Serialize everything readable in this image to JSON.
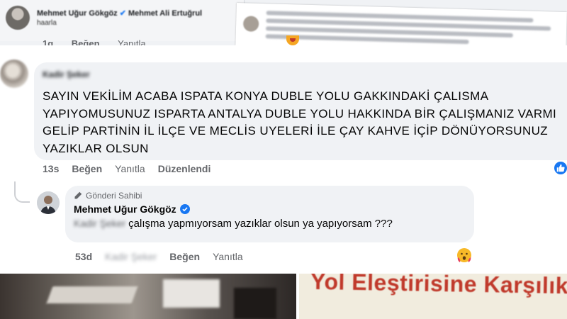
{
  "top": {
    "left_card_name": "Mehmet Uğur Gökgöz",
    "left_card_mention": "Mehmet Ali Ertuğrul",
    "left_card_snippet": "haarla",
    "actions": {
      "time": "1g",
      "like": "Beğen",
      "reply": "Yanıtla"
    }
  },
  "comment": {
    "author": "Kadir Şeker",
    "text": "SAYIN VEKİLİM ACABA ISPATA KONYA DUBLE YOLU GAKKINDAKİ ÇALISMA YAPIYOMUSUNUZ ISPARTA ANTALYA DUBLE YOLU HAKKINDA BİR ÇALIŞMANIZ VARMI GELİP PARTİNİN İL İLÇE VE MECLİS UYELERİ İLE ÇAY KAHVE İÇİP DÖNÜYORSUNUZ YAZIKLAR OLSUN",
    "time": "13s",
    "like": "Beğen",
    "reply": "Yanıtla",
    "edited": "Düzenlendi"
  },
  "reply": {
    "owner_label": "Gönderi Sahibi",
    "author": "Mehmet Uğur Gökgöz",
    "mention": "Kadir Şeker",
    "text": "çalışma yapmıyorsam yazıklar olsun ya yapıyorsam ???",
    "time": "53d",
    "hidden_name": "Kadir Şeker",
    "like": "Beğen",
    "reply": "Yanıtla"
  },
  "bottom": {
    "banner_text": "Yol Eleştirisine Karşılık"
  },
  "colors": {
    "bubble_bg": "#f0f2f5",
    "meta_text": "#65676b",
    "like_blue": "#1877f2",
    "banner_red": "#c0392b"
  }
}
